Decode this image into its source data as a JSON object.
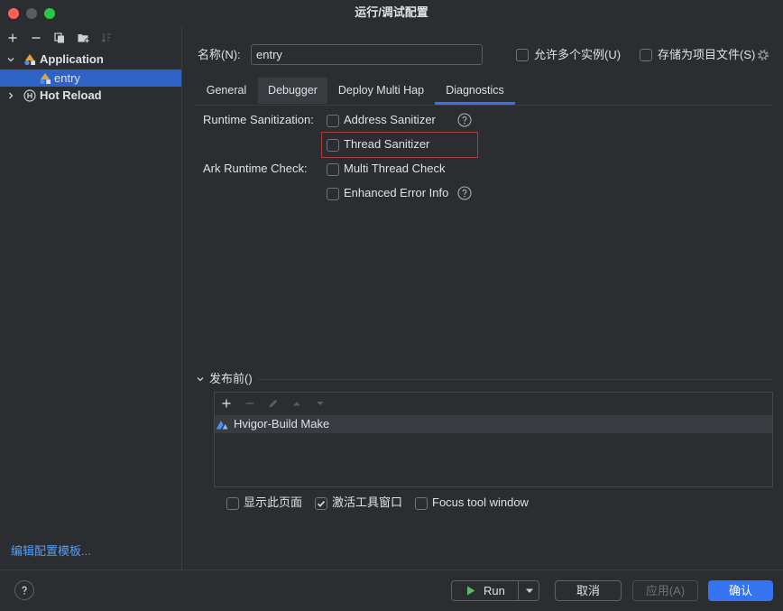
{
  "window": {
    "title": "运行/调试配置"
  },
  "colors": {
    "background": "#2b2d30",
    "text": "#dfe1e5",
    "selection": "#2e62c4",
    "accent": "#3574f0",
    "link": "#589df6",
    "highlight_border": "#a83d3d",
    "run_icon": "#5fb865",
    "traffic_close": "#ff5f57",
    "traffic_minimize": "#5b5c5f",
    "traffic_zoom": "#2ac840"
  },
  "sidebar": {
    "toolbar_icons": [
      "add-icon",
      "remove-icon",
      "copy-icon",
      "folder-add-icon",
      "sort-icon"
    ],
    "tree": [
      {
        "label": "Application",
        "expanded": true,
        "icon": "application-config-icon",
        "children": [
          {
            "label": "entry",
            "selected": true,
            "icon": "application-config-icon"
          }
        ]
      },
      {
        "label": "Hot Reload",
        "expanded": false,
        "icon": "hot-reload-icon"
      }
    ],
    "edit_templates_link": "编辑配置模板..."
  },
  "config": {
    "name_label": "名称(N):",
    "name_value": "entry",
    "allow_multiple_instances": {
      "label": "允许多个实例(U)",
      "checked": false
    },
    "store_as_project_file": {
      "label": "存储为项目文件(S)",
      "checked": false
    },
    "tabs": [
      {
        "label": "General",
        "active": false
      },
      {
        "label": "Debugger",
        "active": false
      },
      {
        "label": "Deploy Multi Hap",
        "active": false
      },
      {
        "label": "Diagnostics",
        "active": true
      }
    ]
  },
  "diagnostics": {
    "runtime_sanitization_label": "Runtime Sanitization:",
    "address_sanitizer": {
      "label": "Address Sanitizer",
      "checked": false
    },
    "thread_sanitizer": {
      "label": "Thread Sanitizer",
      "checked": false,
      "highlighted": true
    },
    "ark_runtime_check_label": "Ark Runtime Check:",
    "multi_thread_check": {
      "label": "Multi Thread Check",
      "checked": false
    },
    "enhanced_error_info": {
      "label": "Enhanced Error Info",
      "checked": false
    }
  },
  "before_launch": {
    "title": "发布前()",
    "expanded": true,
    "toolbar_icons": [
      "add-icon",
      "remove-icon",
      "edit-icon",
      "move-up-icon",
      "move-down-icon"
    ],
    "tasks": [
      {
        "label": "Hvigor-Build Make",
        "icon": "hvigor-icon"
      }
    ],
    "show_this_page": {
      "label": "显示此页面",
      "checked": false
    },
    "activate_tool_window": {
      "label": "激活工具窗口",
      "checked": true
    },
    "focus_tool_window": {
      "label": "Focus tool window",
      "checked": false
    }
  },
  "footer": {
    "run_label": "Run",
    "cancel_label": "取消",
    "apply_label": "应用(A)",
    "apply_disabled": true,
    "ok_label": "确认"
  }
}
